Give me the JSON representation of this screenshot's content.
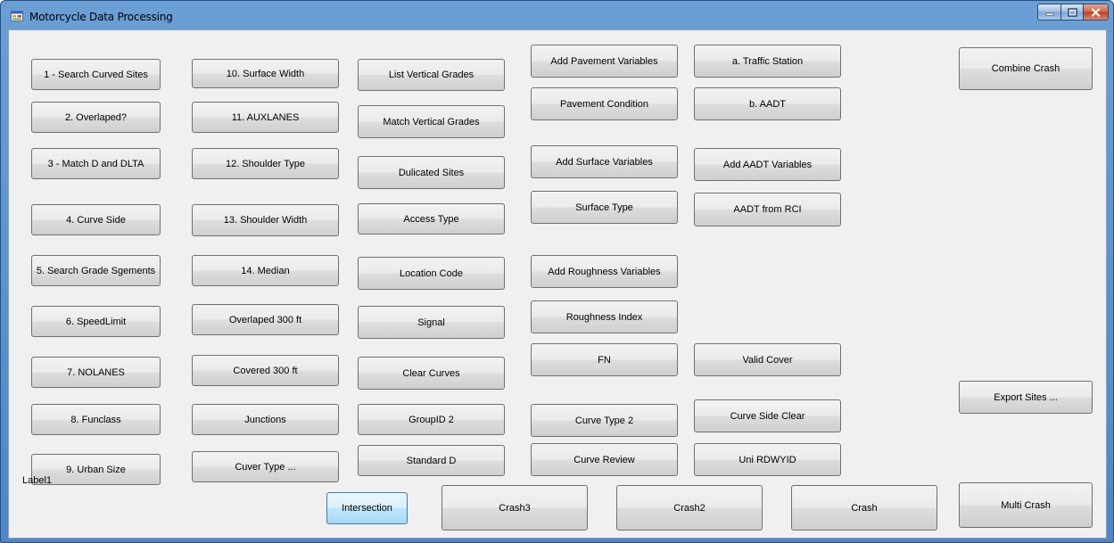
{
  "window": {
    "title": "Motorcycle Data Processing",
    "controls": [
      "minimize",
      "maximize",
      "close"
    ]
  },
  "colors": {
    "titlebar": "#5b93cc",
    "client_bg": "#f0f0f0",
    "button_bg": "#dddddd",
    "button_focus": "#bee6fd",
    "close_button": "#c7502c"
  },
  "buttons": {
    "search_curved_sites": "1 - Search Curved Sites",
    "overlaped": "2. Overlaped?",
    "match_d_dlta": "3 - Match D and DLTA",
    "curve_side": "4. Curve Side",
    "search_grade_segments": "5.  Search Grade Sgements",
    "speedlimit": "6. SpeedLimit",
    "nolanes": "7. NOLANES",
    "funclass": "8. Funclass",
    "urban_size": "9. Urban Size",
    "surface_width": "10. Surface Width",
    "auxlanes": "11. AUXLANES",
    "shoulder_type": "12. Shoulder Type",
    "shoulder_width": "13. Shoulder Width",
    "median": "14. Median",
    "overlaped_300": "Overlaped 300 ft",
    "covered_300": "Covered 300 ft",
    "junctions": "Junctions",
    "cuver_type": "Cuver Type ...",
    "list_vertical_grades": "List Vertical Grades",
    "match_vertical_grades": "Match Vertical Grades",
    "dulicated_sites": "Dulicated Sites",
    "access_type": "Access Type",
    "location_code": "Location Code",
    "signal": "Signal",
    "clear_curves": "Clear Curves",
    "groupid2": "GroupID 2",
    "standard_d": "Standard D",
    "add_pavement_variables": "Add Pavement Variables",
    "pavement_condition": "Pavement Condition",
    "add_surface_variables": "Add Surface Variables",
    "surface_type": "Surface Type",
    "add_roughness_variables": "Add Roughness Variables",
    "roughness_index": "Roughness Index",
    "fn": "FN",
    "curve_type_2": "Curve Type 2",
    "curve_review": "Curve Review",
    "traffic_station": "a. Traffic Station",
    "aadt": "b. AADT",
    "add_aadt_variables": "Add AADT Variables",
    "aadt_from_rci": "AADT from RCI",
    "valid_cover": "Valid Cover",
    "curve_side_clear": "Curve Side Clear",
    "uni_rdwyid": "Uni RDWYID",
    "combine_crash": "Combine Crash",
    "export_sites": "Export Sites ...",
    "multi_crash": "Multi Crash",
    "intersection": "Intersection",
    "crash3": "Crash3",
    "crash2": "Crash2",
    "crash": "Crash"
  },
  "label1": "Label1"
}
